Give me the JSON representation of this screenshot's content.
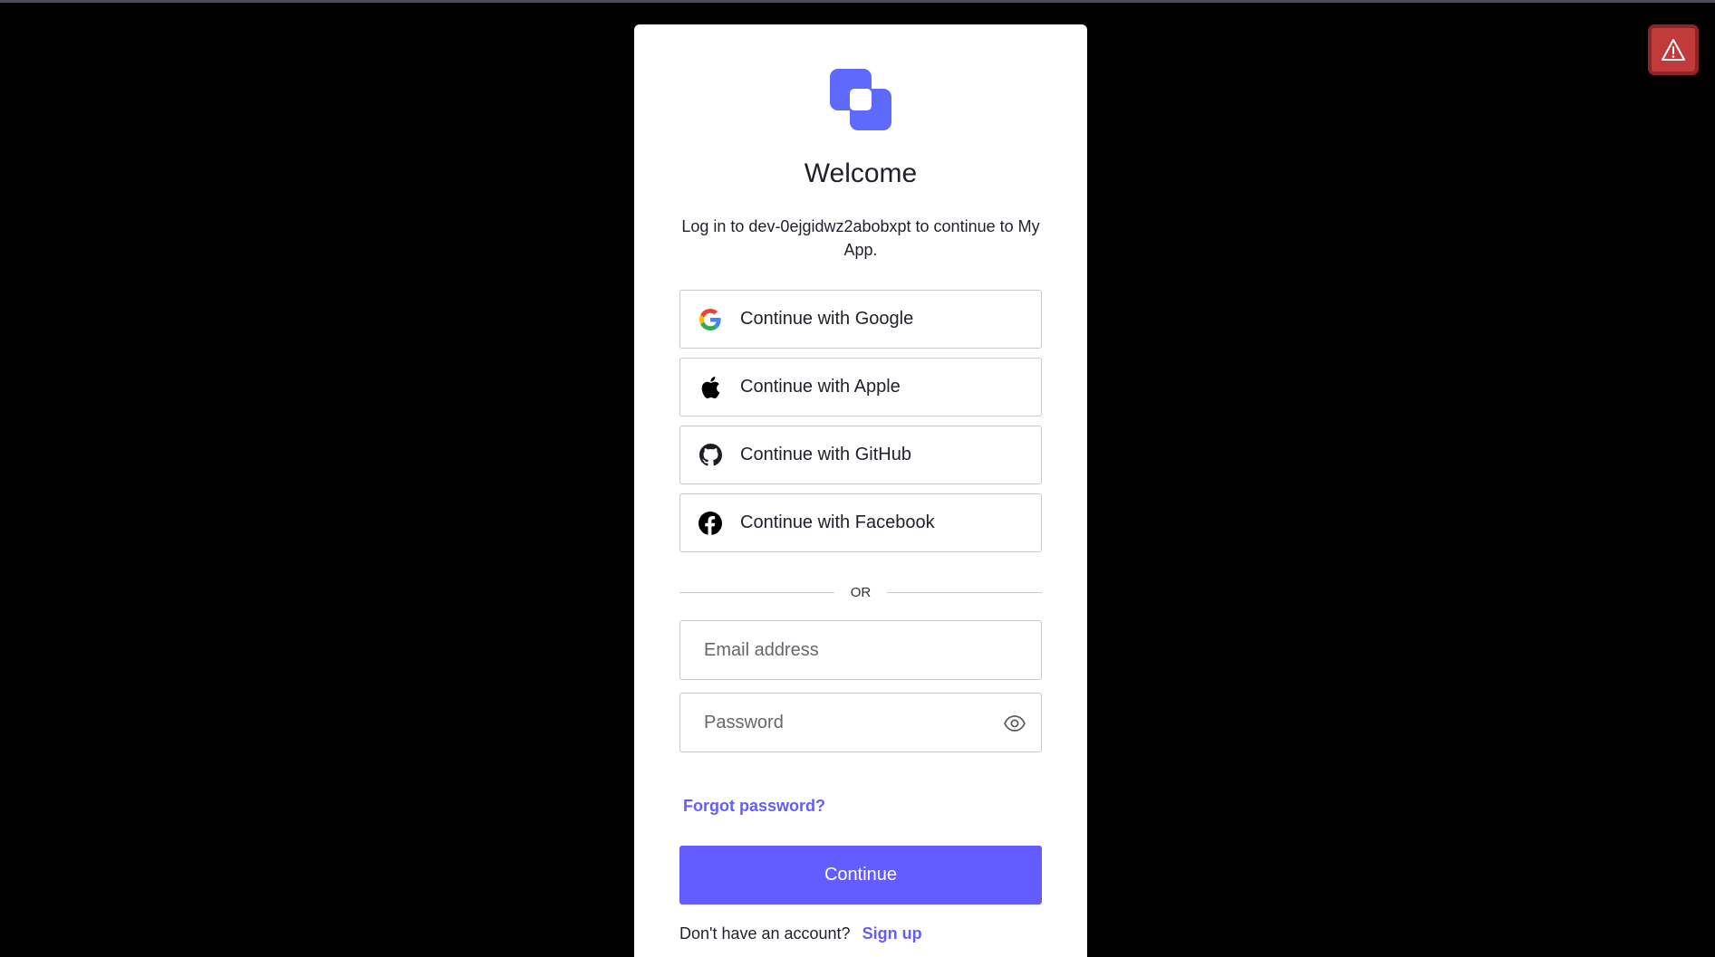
{
  "login": {
    "title": "Welcome",
    "subtitle": "Log in to dev-0ejgidwz2abobxpt to continue to My App.",
    "social": [
      {
        "label": "Continue with Google",
        "icon": "google-icon"
      },
      {
        "label": "Continue with Apple",
        "icon": "apple-icon"
      },
      {
        "label": "Continue with GitHub",
        "icon": "github-icon"
      },
      {
        "label": "Continue with Facebook",
        "icon": "facebook-icon"
      }
    ],
    "divider_text": "OR",
    "email": {
      "placeholder": "Email address",
      "value": ""
    },
    "password": {
      "placeholder": "Password",
      "value": ""
    },
    "forgot_password": "Forgot password?",
    "continue_label": "Continue",
    "signup_prompt": "Don't have an account?",
    "signup_link": "Sign up"
  },
  "colors": {
    "background": "#000000",
    "card": "#ffffff",
    "accent": "#635dff",
    "logo": "#5d6afb",
    "warning": "#c23b3b"
  },
  "icons": {
    "warning": "warning-triangle-icon",
    "logo": "app-logo",
    "password_toggle": "eye-icon"
  }
}
